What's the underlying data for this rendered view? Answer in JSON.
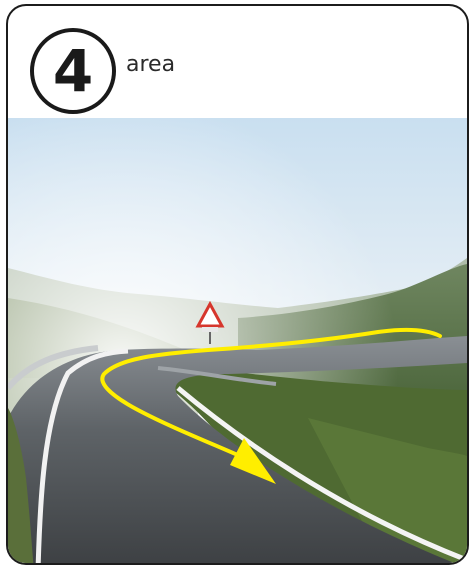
{
  "badge": {
    "number": "4"
  },
  "title": "area",
  "photo": {
    "subject": "road-curve-photo",
    "arrow_color": "#ffee00"
  }
}
